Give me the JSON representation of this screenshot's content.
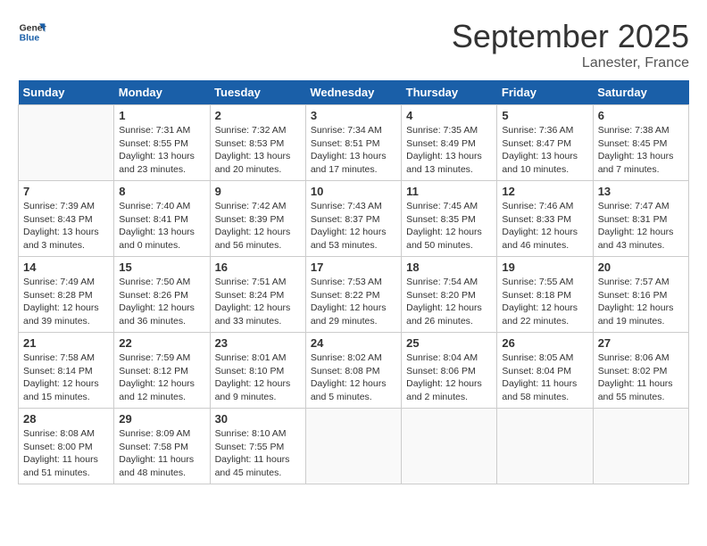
{
  "header": {
    "logo_line1": "General",
    "logo_line2": "Blue",
    "month_title": "September 2025",
    "location": "Lanester, France"
  },
  "weekdays": [
    "Sunday",
    "Monday",
    "Tuesday",
    "Wednesday",
    "Thursday",
    "Friday",
    "Saturday"
  ],
  "weeks": [
    [
      {
        "date": "",
        "sunrise": "",
        "sunset": "",
        "daylight": ""
      },
      {
        "date": "1",
        "sunrise": "Sunrise: 7:31 AM",
        "sunset": "Sunset: 8:55 PM",
        "daylight": "Daylight: 13 hours and 23 minutes."
      },
      {
        "date": "2",
        "sunrise": "Sunrise: 7:32 AM",
        "sunset": "Sunset: 8:53 PM",
        "daylight": "Daylight: 13 hours and 20 minutes."
      },
      {
        "date": "3",
        "sunrise": "Sunrise: 7:34 AM",
        "sunset": "Sunset: 8:51 PM",
        "daylight": "Daylight: 13 hours and 17 minutes."
      },
      {
        "date": "4",
        "sunrise": "Sunrise: 7:35 AM",
        "sunset": "Sunset: 8:49 PM",
        "daylight": "Daylight: 13 hours and 13 minutes."
      },
      {
        "date": "5",
        "sunrise": "Sunrise: 7:36 AM",
        "sunset": "Sunset: 8:47 PM",
        "daylight": "Daylight: 13 hours and 10 minutes."
      },
      {
        "date": "6",
        "sunrise": "Sunrise: 7:38 AM",
        "sunset": "Sunset: 8:45 PM",
        "daylight": "Daylight: 13 hours and 7 minutes."
      }
    ],
    [
      {
        "date": "7",
        "sunrise": "Sunrise: 7:39 AM",
        "sunset": "Sunset: 8:43 PM",
        "daylight": "Daylight: 13 hours and 3 minutes."
      },
      {
        "date": "8",
        "sunrise": "Sunrise: 7:40 AM",
        "sunset": "Sunset: 8:41 PM",
        "daylight": "Daylight: 13 hours and 0 minutes."
      },
      {
        "date": "9",
        "sunrise": "Sunrise: 7:42 AM",
        "sunset": "Sunset: 8:39 PM",
        "daylight": "Daylight: 12 hours and 56 minutes."
      },
      {
        "date": "10",
        "sunrise": "Sunrise: 7:43 AM",
        "sunset": "Sunset: 8:37 PM",
        "daylight": "Daylight: 12 hours and 53 minutes."
      },
      {
        "date": "11",
        "sunrise": "Sunrise: 7:45 AM",
        "sunset": "Sunset: 8:35 PM",
        "daylight": "Daylight: 12 hours and 50 minutes."
      },
      {
        "date": "12",
        "sunrise": "Sunrise: 7:46 AM",
        "sunset": "Sunset: 8:33 PM",
        "daylight": "Daylight: 12 hours and 46 minutes."
      },
      {
        "date": "13",
        "sunrise": "Sunrise: 7:47 AM",
        "sunset": "Sunset: 8:31 PM",
        "daylight": "Daylight: 12 hours and 43 minutes."
      }
    ],
    [
      {
        "date": "14",
        "sunrise": "Sunrise: 7:49 AM",
        "sunset": "Sunset: 8:28 PM",
        "daylight": "Daylight: 12 hours and 39 minutes."
      },
      {
        "date": "15",
        "sunrise": "Sunrise: 7:50 AM",
        "sunset": "Sunset: 8:26 PM",
        "daylight": "Daylight: 12 hours and 36 minutes."
      },
      {
        "date": "16",
        "sunrise": "Sunrise: 7:51 AM",
        "sunset": "Sunset: 8:24 PM",
        "daylight": "Daylight: 12 hours and 33 minutes."
      },
      {
        "date": "17",
        "sunrise": "Sunrise: 7:53 AM",
        "sunset": "Sunset: 8:22 PM",
        "daylight": "Daylight: 12 hours and 29 minutes."
      },
      {
        "date": "18",
        "sunrise": "Sunrise: 7:54 AM",
        "sunset": "Sunset: 8:20 PM",
        "daylight": "Daylight: 12 hours and 26 minutes."
      },
      {
        "date": "19",
        "sunrise": "Sunrise: 7:55 AM",
        "sunset": "Sunset: 8:18 PM",
        "daylight": "Daylight: 12 hours and 22 minutes."
      },
      {
        "date": "20",
        "sunrise": "Sunrise: 7:57 AM",
        "sunset": "Sunset: 8:16 PM",
        "daylight": "Daylight: 12 hours and 19 minutes."
      }
    ],
    [
      {
        "date": "21",
        "sunrise": "Sunrise: 7:58 AM",
        "sunset": "Sunset: 8:14 PM",
        "daylight": "Daylight: 12 hours and 15 minutes."
      },
      {
        "date": "22",
        "sunrise": "Sunrise: 7:59 AM",
        "sunset": "Sunset: 8:12 PM",
        "daylight": "Daylight: 12 hours and 12 minutes."
      },
      {
        "date": "23",
        "sunrise": "Sunrise: 8:01 AM",
        "sunset": "Sunset: 8:10 PM",
        "daylight": "Daylight: 12 hours and 9 minutes."
      },
      {
        "date": "24",
        "sunrise": "Sunrise: 8:02 AM",
        "sunset": "Sunset: 8:08 PM",
        "daylight": "Daylight: 12 hours and 5 minutes."
      },
      {
        "date": "25",
        "sunrise": "Sunrise: 8:04 AM",
        "sunset": "Sunset: 8:06 PM",
        "daylight": "Daylight: 12 hours and 2 minutes."
      },
      {
        "date": "26",
        "sunrise": "Sunrise: 8:05 AM",
        "sunset": "Sunset: 8:04 PM",
        "daylight": "Daylight: 11 hours and 58 minutes."
      },
      {
        "date": "27",
        "sunrise": "Sunrise: 8:06 AM",
        "sunset": "Sunset: 8:02 PM",
        "daylight": "Daylight: 11 hours and 55 minutes."
      }
    ],
    [
      {
        "date": "28",
        "sunrise": "Sunrise: 8:08 AM",
        "sunset": "Sunset: 8:00 PM",
        "daylight": "Daylight: 11 hours and 51 minutes."
      },
      {
        "date": "29",
        "sunrise": "Sunrise: 8:09 AM",
        "sunset": "Sunset: 7:58 PM",
        "daylight": "Daylight: 11 hours and 48 minutes."
      },
      {
        "date": "30",
        "sunrise": "Sunrise: 8:10 AM",
        "sunset": "Sunset: 7:55 PM",
        "daylight": "Daylight: 11 hours and 45 minutes."
      },
      {
        "date": "",
        "sunrise": "",
        "sunset": "",
        "daylight": ""
      },
      {
        "date": "",
        "sunrise": "",
        "sunset": "",
        "daylight": ""
      },
      {
        "date": "",
        "sunrise": "",
        "sunset": "",
        "daylight": ""
      },
      {
        "date": "",
        "sunrise": "",
        "sunset": "",
        "daylight": ""
      }
    ]
  ]
}
